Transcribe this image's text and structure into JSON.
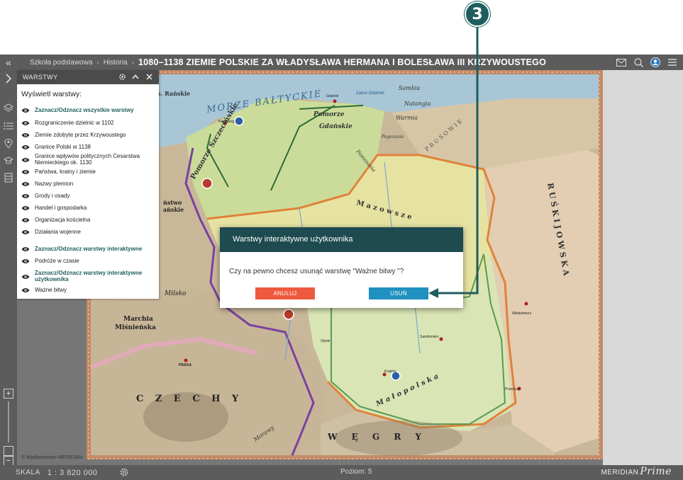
{
  "callout": {
    "number": "3"
  },
  "topbar": {
    "breadcrumbs": [
      "Szkoła podstawowa",
      "Historia"
    ],
    "title": "1080–1138 ZIEMIE POLSKIE ZA WŁADYSŁAWA HERMANA I BOLESŁAWA III KRZYWOUSTEGO",
    "icons": [
      "mail-icon",
      "search-icon",
      "user-icon",
      "menu-icon"
    ]
  },
  "rail": {
    "icons": [
      "layers-icon",
      "list-icon",
      "map-pin-icon",
      "graduation-icon",
      "book-icon"
    ],
    "zoom_in": "+",
    "zoom_out": "−"
  },
  "layers_panel": {
    "header": "WARSTWY",
    "subtitle": "Wyświetl warstwy:",
    "items": [
      {
        "label": "Zaznacz/Odznacz wszystkie warstwy",
        "bold": true
      },
      {
        "label": "Rozgraniczenie dzielnic w 1102",
        "bold": false
      },
      {
        "label": "Ziemie zdobyte przez Krzywoustego",
        "bold": false
      },
      {
        "label": "Granice Polski w 1138",
        "bold": false
      },
      {
        "label": "Granice wpływów politycznych Cesarstwa Niemieckiego ok. 1130",
        "bold": false
      },
      {
        "label": "Państwa, krainy i ziemie",
        "bold": false
      },
      {
        "label": "Nazwy plemion",
        "bold": false
      },
      {
        "label": "Grody i osady",
        "bold": false
      },
      {
        "label": "Handel i gospodarka",
        "bold": false
      },
      {
        "label": "Organizacja kościelna",
        "bold": false
      },
      {
        "label": "Działania wojenne",
        "bold": false
      },
      {
        "label": "Zaznacz/Odznacz warstwy interaktywne",
        "bold": true
      },
      {
        "label": "Podróże w czasie",
        "bold": false
      },
      {
        "label": "Zaznacz/Odznacz warstwy interaktywne użytkownika",
        "bold": true
      },
      {
        "label": "Ważne bitwy",
        "bold": false
      }
    ]
  },
  "dialog": {
    "title": "Warstwy interaktywne użytkownika",
    "message": "Czy na pewno chcesz usunąć warstwę \"Ważne bitwy \"?",
    "cancel_label": "ANULUJ",
    "delete_label": "USUŃ"
  },
  "map_labels": {
    "sea": "MORZE BAŁTYCKIE",
    "pomorze_szczecinskie": "Pomorze Szczecińskie",
    "pomorze_gdanskie": "Pomorze Gdańskie",
    "pomorze": "Pomorze",
    "gdanskie": "Gdańskie",
    "mazowsze": "M a z o w s z e",
    "rus": "R U Ś   K I J O W S K A",
    "czechy": "C Z E C H Y",
    "wegry": "W Ę G R Y",
    "malopolska": "M a ł o p o l s k a",
    "marchia": "Marchia",
    "misnienska": "Miśnieńska",
    "sambia": "Sambia",
    "natangia": "Natangia",
    "warmia": "Warmia",
    "pogezania": "Pogezania",
    "prusowie": "P R U S O W I E",
    "pomezania": "Pomezania",
    "morawy": "Morawy",
    "ranskie": "s. Rańskie",
    "zalew": "Zalew Gdański",
    "milsko": "Milsko",
    "wo_ladzie": "ństwo",
    "nskie": "ańskie",
    "gdansk": "Gdańsk",
    "kolobrzeg": "Kołobrzeg",
    "krakow": "Kraków",
    "praga": "PRAGA",
    "opole": "Opole",
    "sandomierz": "Sandomierz",
    "wlodzimierz": "Włodzimierz",
    "przemysl": "Przemyśl"
  },
  "bottombar": {
    "scale_label": "SKALA",
    "scale_value": "1 : 3 820 000",
    "level": "Poziom: 5",
    "brand": "MERIDIAN",
    "brand_suffix": "Prime"
  },
  "copyright": "© Wydawnictwo MERIDIAN",
  "colors": {
    "dialog_header": "#1d4b4f",
    "cancel": "#ee5a3e",
    "delete": "#2090c0",
    "callout": "#1f5e5e",
    "toolbar": "#5c5c5c"
  }
}
